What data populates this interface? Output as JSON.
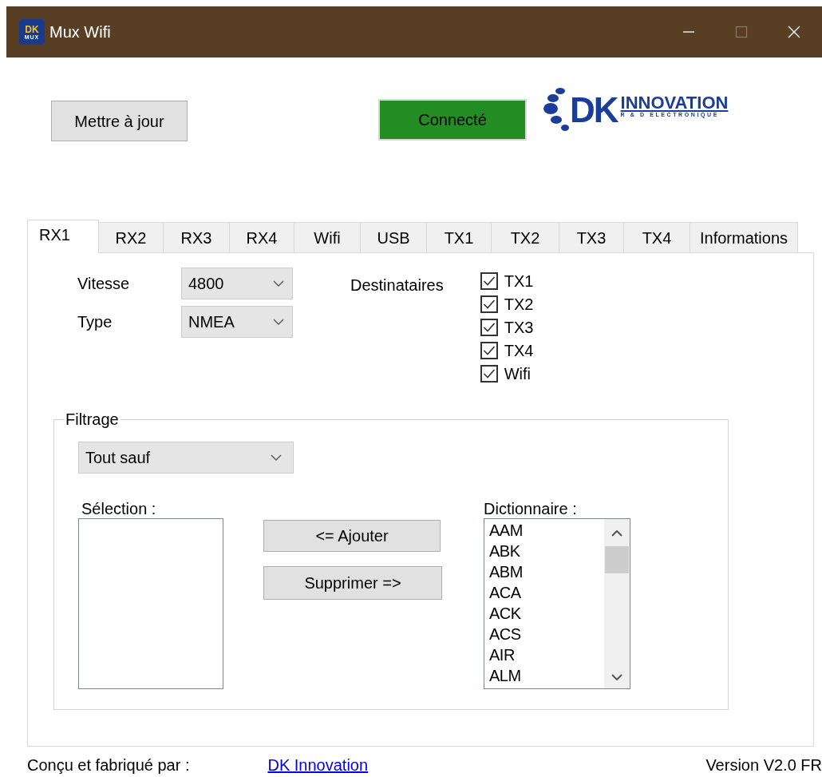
{
  "window": {
    "title": "Mux Wifi",
    "icon_text": [
      "DK",
      "MUX"
    ],
    "title_buttons": [
      {
        "kind": "minimize",
        "disabled": false
      },
      {
        "kind": "maximize",
        "disabled": true
      },
      {
        "kind": "close",
        "disabled": false
      }
    ]
  },
  "top": {
    "update_button": "Mettre à jour",
    "status": {
      "text": "Connecté",
      "connected": true
    },
    "logo": {
      "mark": "DK",
      "word": "INNOVATION",
      "tagline": "R & D ELECTRONIQUE"
    }
  },
  "tabs": [
    {
      "label": "RX1",
      "selected": true
    },
    {
      "label": "RX2",
      "selected": false
    },
    {
      "label": "RX3",
      "selected": false
    },
    {
      "label": "RX4",
      "selected": false
    },
    {
      "label": "Wifi",
      "selected": false
    },
    {
      "label": "USB",
      "selected": false
    },
    {
      "label": "TX1",
      "selected": false
    },
    {
      "label": "TX2",
      "selected": false
    },
    {
      "label": "TX3",
      "selected": false
    },
    {
      "label": "TX4",
      "selected": false
    },
    {
      "label": "Informations",
      "selected": false
    }
  ],
  "rx_settings": {
    "fields": [
      {
        "label": "Vitesse",
        "value": "4800"
      },
      {
        "label": "Type",
        "value": "NMEA"
      }
    ],
    "recipients_label": "Destinataires",
    "recipients": [
      {
        "label": "TX1",
        "checked": true
      },
      {
        "label": "TX2",
        "checked": true
      },
      {
        "label": "TX3",
        "checked": true
      },
      {
        "label": "TX4",
        "checked": true
      },
      {
        "label": "Wifi",
        "checked": true
      }
    ]
  },
  "filter": {
    "title": "Filtrage",
    "mode": "Tout sauf",
    "selection_label": "Sélection :",
    "add_button": "<= Ajouter",
    "remove_button": "Supprimer =>",
    "dictionary_label": "Dictionnaire :",
    "dictionary": [
      "AAM",
      "ABK",
      "ABM",
      "ACA",
      "ACK",
      "ACS",
      "AIR",
      "ALM"
    ]
  },
  "footer": {
    "credit": "Conçu et fabriqué par :",
    "link": "DK Innovation",
    "version": "Version V2.0 FR"
  }
}
